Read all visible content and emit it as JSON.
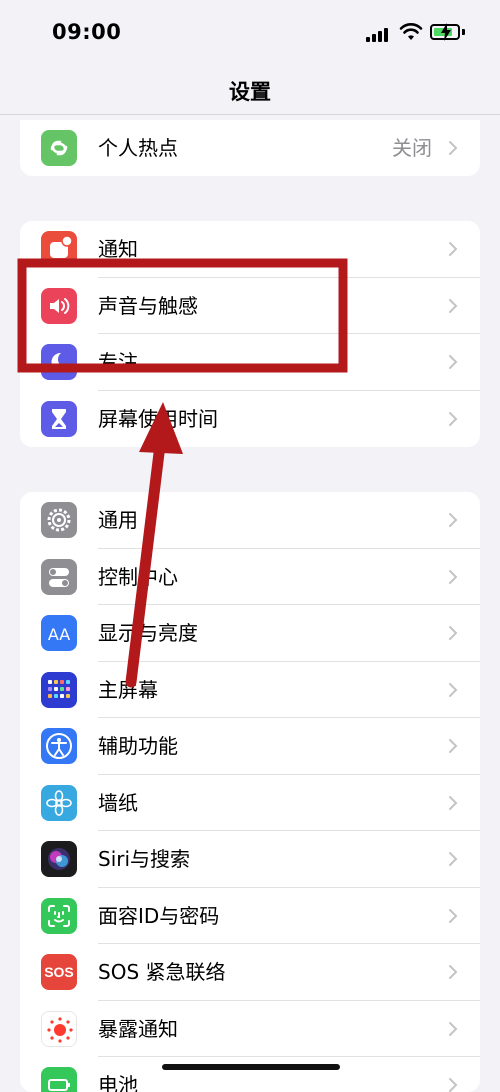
{
  "status_bar": {
    "time": "09:00",
    "battery_color": "#4cd964"
  },
  "nav": {
    "title": "设置"
  },
  "groups": [
    {
      "items": [
        {
          "label": "个人热点",
          "value": "关闭",
          "icon": "hotspot-icon",
          "icon_color": "#65c466"
        }
      ]
    },
    {
      "items": [
        {
          "label": "通知",
          "icon": "notifications-icon",
          "icon_color": "#eb4d3d"
        },
        {
          "label": "声音与触感",
          "icon": "sound-icon",
          "icon_color": "#eb445a"
        },
        {
          "label": "专注",
          "icon": "focus-icon",
          "icon_color": "#5e5ce6"
        },
        {
          "label": "屏幕使用时间",
          "icon": "screen-time-icon",
          "icon_color": "#5e5ce6"
        }
      ]
    },
    {
      "items": [
        {
          "label": "通用",
          "icon": "gear-icon",
          "icon_color": "#8e8e93"
        },
        {
          "label": "控制中心",
          "icon": "control-center-icon",
          "icon_color": "#8e8e93"
        },
        {
          "label": "显示与亮度",
          "icon": "display-icon",
          "icon_color": "#3478f6"
        },
        {
          "label": "主屏幕",
          "icon": "home-screen-icon",
          "icon_color": "#3d4bd9"
        },
        {
          "label": "辅助功能",
          "icon": "accessibility-icon",
          "icon_color": "#3478f6"
        },
        {
          "label": "墙纸",
          "icon": "wallpaper-icon",
          "icon_color": "#38a8e0"
        },
        {
          "label": "Siri与搜索",
          "icon": "siri-icon",
          "icon_color": "#1c1c1e"
        },
        {
          "label": "面容ID与密码",
          "icon": "face-id-icon",
          "icon_color": "#34c759"
        },
        {
          "label": "SOS 紧急联络",
          "icon": "sos-icon",
          "icon_color": "#e5453a",
          "icon_text": "SOS"
        },
        {
          "label": "暴露通知",
          "icon": "exposure-icon",
          "icon_color": "#ffffff"
        },
        {
          "label": "电池",
          "icon": "battery-icon",
          "icon_color": "#34c759"
        }
      ]
    }
  ],
  "annotation": {
    "color": "#b3181b",
    "highlight": "声音与触感"
  }
}
